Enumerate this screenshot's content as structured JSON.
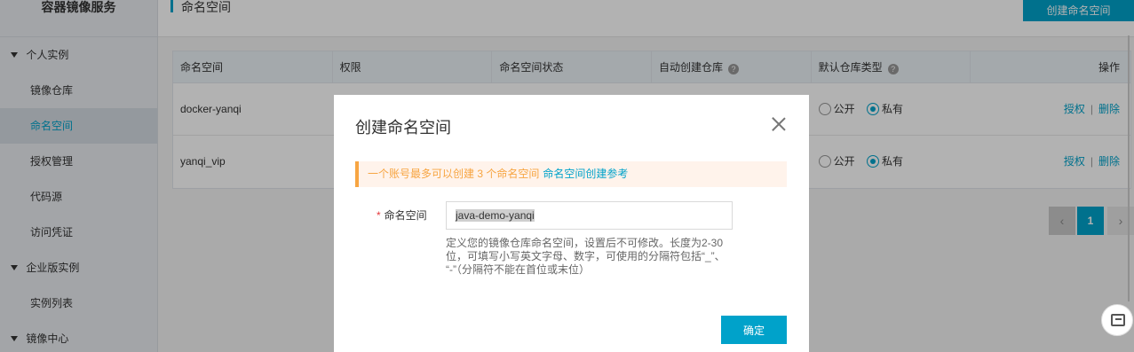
{
  "sidebar": {
    "brand": "容器镜像服务",
    "groups": [
      {
        "label": "个人实例",
        "items": [
          "镜像仓库",
          "命名空间",
          "授权管理",
          "代码源",
          "访问凭证"
        ]
      },
      {
        "label": "企业版实例",
        "items": [
          "实例列表"
        ]
      },
      {
        "label": "镜像中心",
        "items": []
      }
    ],
    "active_item": "命名空间"
  },
  "header": {
    "title": "命名空间",
    "create_button": "创建命名空间"
  },
  "table": {
    "columns": [
      "命名空间",
      "权限",
      "命名空间状态",
      "自动创建仓库",
      "默认仓库类型",
      "操作"
    ],
    "rows": [
      {
        "name": "docker-yanqi",
        "repo_type_public": "公开",
        "repo_type_private": "私有",
        "selected": "私有",
        "action_auth": "授权",
        "action_delete": "删除"
      },
      {
        "name": "yanqi_vip",
        "repo_type_public": "公开",
        "repo_type_private": "私有",
        "selected": "私有",
        "action_auth": "授权",
        "action_delete": "删除"
      }
    ],
    "separator": "|"
  },
  "pagination": {
    "current": "1",
    "prev": "‹",
    "next": "›"
  },
  "modal": {
    "title": "创建命名空间",
    "notice_text": "一个账号最多可以创建 3 个命名空间",
    "notice_link": "命名空间创建参考",
    "field_label": "命名空间",
    "required_mark": "*",
    "field_value": "java-demo-yanqi",
    "hint_line1": "定义您的镜像仓库命名空间，设置后不可修改。长度为2-30",
    "hint_line2": "位，可填写小写英文字母、数字，可使用的分隔符包括“_”、",
    "hint_line3": "“-”（分隔符不能在首位或末位）",
    "confirm_button": "确定"
  },
  "colors": {
    "accent": "#00a2ca",
    "warning": "#f7a542",
    "sidebar_bg": "#eaedf1"
  }
}
